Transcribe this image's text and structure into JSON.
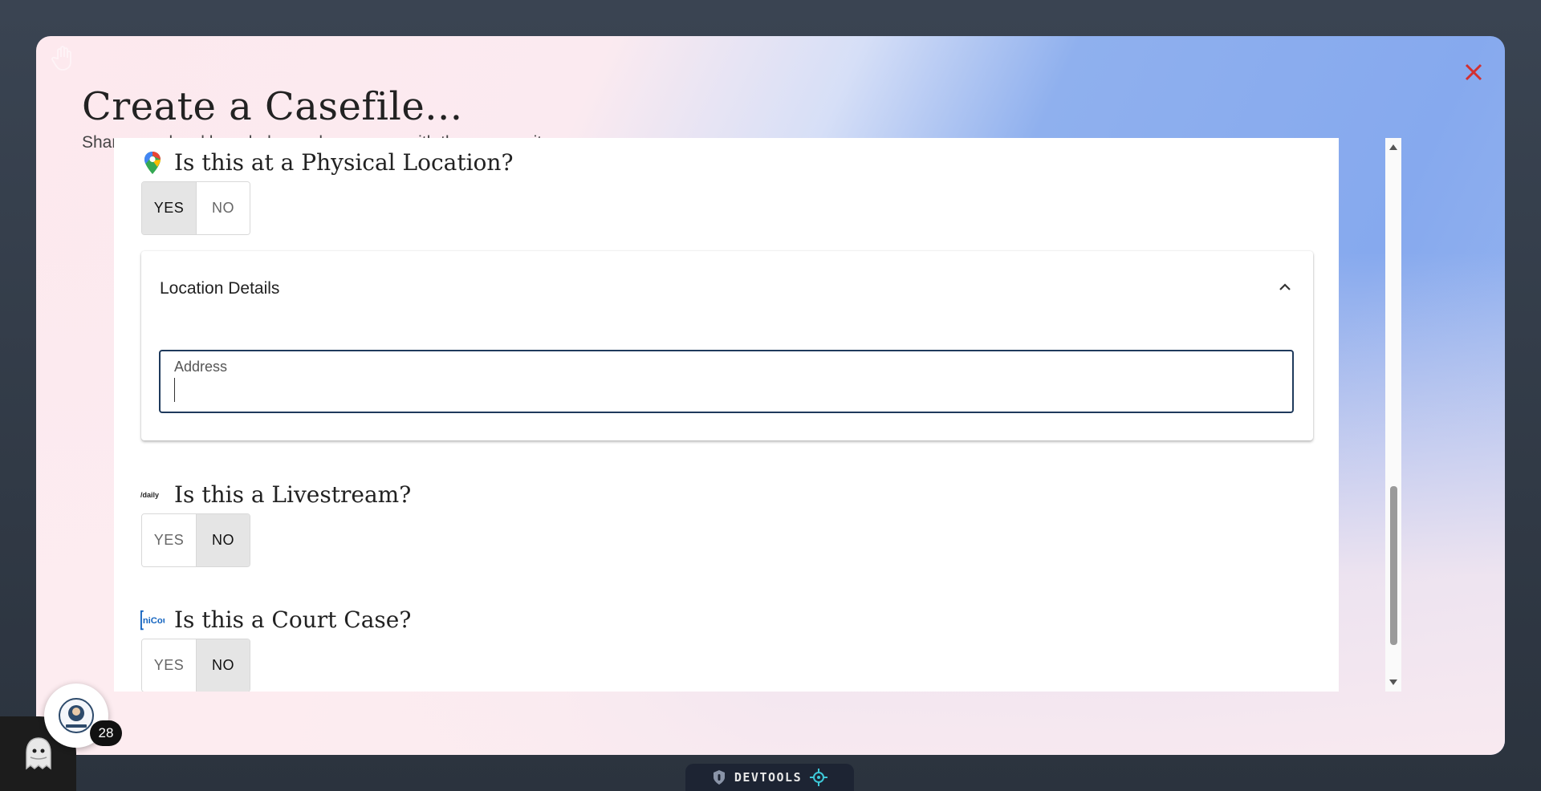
{
  "modal": {
    "title": "Create a Casefile...",
    "subtitle": "Share your legal knowledge and resources with the community"
  },
  "questions": {
    "location": {
      "label": "Is this at a Physical Location?",
      "icon": "google-maps-pin-icon",
      "yes": "YES",
      "no": "NO",
      "selected": "YES"
    },
    "livestream": {
      "label": "Is this a Livestream?",
      "icon": "daily-logo-icon",
      "yes": "YES",
      "no": "NO",
      "selected": "NO"
    },
    "court": {
      "label": "Is this a Court Case?",
      "icon": "unicourt-logo-icon",
      "yes": "YES",
      "no": "NO",
      "selected": "NO"
    }
  },
  "location_details": {
    "title": "Location Details",
    "address_label": "Address",
    "address_value": ""
  },
  "notification_badge": "28",
  "devtools_label": "DEVTOOLS",
  "colors": {
    "close": "#d32f2f",
    "field_border": "#1f3a5c",
    "selected_option_bg": "#e5e5e5"
  }
}
